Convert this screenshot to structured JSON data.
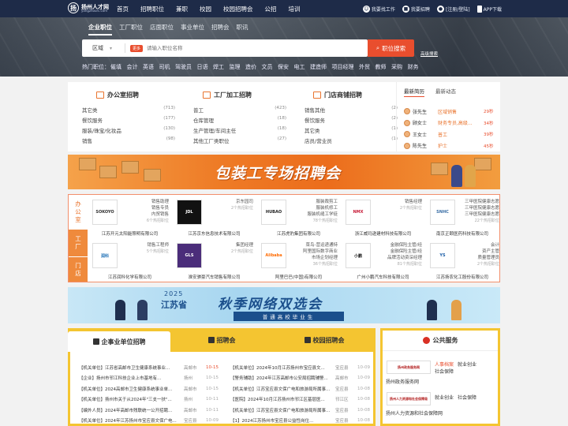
{
  "header": {
    "logo_text": "扬州人才网",
    "logo_sub": "yangzhourc.com",
    "nav": [
      "首页",
      "招聘职位",
      "兼职",
      "校园",
      "校园招聘会",
      "公招",
      "培训"
    ],
    "links": {
      "find_job": "我要找工作",
      "hire": "我要招聘",
      "login": "[注册/登陆]",
      "app": "APP下载"
    }
  },
  "search": {
    "tabs": [
      "企业职位",
      "工厂职位",
      "店面职位",
      "事业单位",
      "招聘会",
      "职讯"
    ],
    "city": "区域",
    "tag": "更多",
    "placeholder": "请输入职位名称",
    "button": "职位搜索",
    "advanced": "高级搜索",
    "hot_label": "热门职位：",
    "hot": [
      "催填",
      "会计",
      "英语",
      "司机",
      "驾驶员",
      "日语",
      "焊工",
      "监理",
      "造价",
      "文员",
      "保安",
      "电工",
      "建造师",
      "项目经理",
      "外贸",
      "教师",
      "采购",
      "财务"
    ]
  },
  "categories": [
    {
      "title": "办公室招聘",
      "items": [
        [
          "其它类",
          "(713)"
        ],
        [
          "餐饮服务",
          "(177)"
        ],
        [
          "服装/珠宝/化妆品",
          "(130)"
        ],
        [
          "销售",
          "(98)"
        ]
      ]
    },
    {
      "title": "工厂加工招聘",
      "items": [
        [
          "普工",
          "(423)"
        ],
        [
          "仓库管理",
          "(18)"
        ],
        [
          "生产管理/车间主任",
          "(18)"
        ],
        [
          "其他工厂类职位",
          "(27)"
        ]
      ]
    },
    {
      "title": "门店商铺招聘",
      "items": [
        [
          "销售其他",
          "(2)"
        ],
        [
          "餐饮服务",
          "(2)"
        ],
        [
          "其它类",
          "(1)"
        ],
        [
          "店员/营业员",
          "(1)"
        ]
      ]
    }
  ],
  "news": {
    "tabs": [
      "最新简历",
      "最新动态"
    ],
    "items": [
      {
        "name": "张先生",
        "action": "区域销售",
        "time": "29秒"
      },
      {
        "name": "顾女士",
        "action": "财务专员,高级...",
        "time": "34秒"
      },
      {
        "name": "王女士",
        "action": "普工",
        "time": "39秒"
      },
      {
        "name": "陈先生",
        "action": "护士",
        "time": "45秒"
      }
    ]
  },
  "banner1": {
    "title": "包装工专场招聘会"
  },
  "firms": {
    "side": [
      "办公室",
      "工厂",
      "门店"
    ],
    "list": [
      {
        "logo": "SOKOYO",
        "jobs": [
          "销售助理",
          "销售专员",
          "内贸销售"
        ],
        "count": "6个热招职位",
        "name": "江苏开元太阳能照明有限公司"
      },
      {
        "logo": "JDL",
        "jobs": [
          "京东园司",
          "2个热招职位"
        ],
        "count": "",
        "name": "江苏京东信息技术有限公司"
      },
      {
        "logo": "HUBAO",
        "jobs": [
          "服装裁剪工",
          "服装机修工",
          "服装机缝工学徒"
        ],
        "count": "78个热招职位",
        "name": "江苏虎豹集团有限公司"
      },
      {
        "logo": "NMX",
        "jobs": [
          "销售经理",
          "2个热招职位"
        ],
        "count": "",
        "name": "浙江威玛逊建材科技有限公司"
      },
      {
        "logo": "SNHC",
        "jobs": [
          "三甲医院健康志愿",
          "三甲医院健康志愿",
          "三甲医院健康志愿"
        ],
        "count": "22个热招职位",
        "name": "南京正颐医药科技有限公司"
      },
      {
        "logo": "润科",
        "jobs": [
          "销售工程师",
          "5个热招职位"
        ],
        "count": "",
        "name": "江苏润科化学有限公司"
      },
      {
        "logo": "GLS",
        "jobs": [
          "集团经理",
          "2个热招职位"
        ],
        "count": "",
        "name": "淮安骐豪汽车销售有限公司"
      },
      {
        "logo": "Alibaba",
        "jobs": [
          "菜鸟-营运递通特",
          "阿里国际数字商业",
          "市场企划经理"
        ],
        "count": "36个热招职位",
        "name": "阿里巴巴(中国)有限公司"
      },
      {
        "logo": "小鹏",
        "jobs": [
          "金融保险主管/经",
          "金融保险主管/经",
          "品牌活动资深经理"
        ],
        "count": "81个热招职位",
        "name": "广州小鹏汽车科技有限公司"
      },
      {
        "logo": "YS",
        "jobs": [
          "会计",
          "资产主管",
          "质量管理员"
        ],
        "count": "2个热招职位",
        "name": "江苏扬农化工股份有限公司"
      }
    ]
  },
  "banner2": {
    "year": "2025",
    "province": "江苏省",
    "title": "秋季网络双选会",
    "sub": "普通高校毕业生"
  },
  "jobs": {
    "tabs": [
      "企事业单位招聘",
      "招聘会",
      "校园招聘会"
    ],
    "left": [
      {
        "t": "【机关单位】江苏省高邮市卫生健康系统事业...",
        "p": "高邮市",
        "d": "10-15",
        "red": true
      },
      {
        "t": "【企业】扬州市邗江科技企业上市基地有...",
        "p": "扬州",
        "d": "10-15",
        "red": false
      },
      {
        "t": "【机关单位】2024高邮市卫生健康系统事业单...",
        "p": "高邮市",
        "d": "10-15",
        "red": false
      },
      {
        "t": "【机关单位】扬州市关于从2024年\"三支一扶\"...",
        "p": "扬州",
        "d": "10-11",
        "red": false
      },
      {
        "t": "【编外人员】2024年高邮市残联统一公开招聘...",
        "p": "高邮市",
        "d": "10-11",
        "red": false
      },
      {
        "t": "【机关单位】2024年江苏扬州市宝应县文保广电...",
        "p": "宝应县",
        "d": "10-09",
        "red": false
      }
    ],
    "right": [
      {
        "t": "【机关单位】2024年10月江苏扬州市宝应县文...",
        "p": "宝应县",
        "d": "10-09"
      },
      {
        "t": "【警务辅助】2024年江苏高邮市公安局招聘辅警...",
        "p": "高邮市",
        "d": "10-09"
      },
      {
        "t": "【机关单位】江苏宝应县文保广电和旅游局所属事...",
        "p": "宝应县",
        "d": "10-08"
      },
      {
        "t": "【医院】2024年10月江苏扬州市邗江区基层医...",
        "p": "邗江区",
        "d": "10-08"
      },
      {
        "t": "【机关单位】江苏宝应县文保广电和旅游局所属事...",
        "p": "宝应县",
        "d": "10-08"
      },
      {
        "t": "【1】2024江苏扬州市宝应县公益性岗位...",
        "p": "宝应县",
        "d": "10-08"
      }
    ]
  },
  "public": {
    "title": "公共服务",
    "blocks": [
      {
        "logo": "扬州政务服务网",
        "links": [
          "人事档案",
          "就业创业",
          "社会保障"
        ],
        "name": "扬州政务服务网"
      },
      {
        "logo": "扬州人力资源和社会保障局",
        "links": [
          "就业创业",
          "社会保障"
        ],
        "name": "扬州人力资源和社会保障网"
      }
    ]
  }
}
